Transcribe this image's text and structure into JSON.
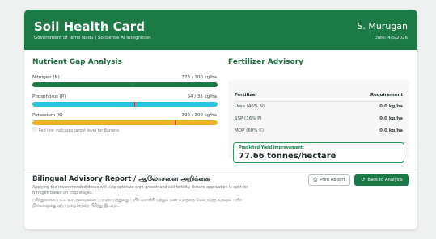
{
  "header": {
    "title": "Soil Health Card",
    "subtitle": "Government of Tamil Nadu | SoilSense AI Integration",
    "user": "S. Murugan",
    "date": "Date: 4/5/2026",
    "accent": "#1b7a46"
  },
  "nutrients": {
    "title": "Nutrient Gap Analysis",
    "items": [
      {
        "label": "Nitrogen (N)",
        "value": "373 / 200 kg/ha",
        "fill_fraction": 1.0,
        "target_fraction": 0.536,
        "color": "#1b7a46"
      },
      {
        "label": "Phosphorus (P)",
        "value": "64 / 35 kg/ha",
        "fill_fraction": 1.0,
        "target_fraction": 0.55,
        "color": "#2bc3e0"
      },
      {
        "label": "Potassium (K)",
        "value": "390 / 300 kg/ha",
        "fill_fraction": 1.0,
        "target_fraction": 0.77,
        "color": "#f0b323"
      }
    ],
    "hint": "Red line indicates target level for Banana"
  },
  "fertilizer": {
    "title": "Fertilizer Advisory",
    "col_fertilizer": "Fertilizer",
    "col_requirement": "Requirement",
    "rows": [
      {
        "name": "Urea (46% N)",
        "amount": "0.0 kg/ha"
      },
      {
        "name": "SSP (16% P)",
        "amount": "0.0 kg/ha"
      },
      {
        "name": "MOP (60% K)",
        "amount": "0.0 kg/ha"
      }
    ],
    "yield_label": "Predicted Yield Improvement:",
    "yield_value": "77.66 tonnes/hectare"
  },
  "bilingual": {
    "title": "Bilingual Advisory Report / ஆலோசனை அறிக்கை",
    "english": "Applying the recommended doses will help optimize crop growth and soil fertility. Ensure application is split for Nitrogen based on crop stages.",
    "tamil": "பரிந்துரைக்கப்பட்ட உர அளவுகளைப் பயன்படுத்துவது பயிர் வளர்ச்சி மற்றும் மண் வளத்தை மேம்படுத்த உதவும். பயிர் நிலைகளுக்கு ஏற்ப தழைச்சத்தை பிரித்து இடவும்."
  },
  "buttons": {
    "print_label": "Print Report",
    "print_icon": "printer-icon",
    "back_label": "Back to Analysis",
    "back_icon": "back-arrow-icon"
  }
}
